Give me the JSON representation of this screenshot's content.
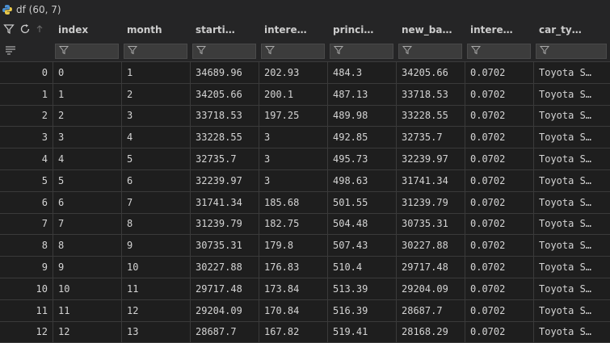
{
  "title": "df (60, 7)",
  "columns": [
    "index",
    "month",
    "starti…",
    "intere…",
    "princi…",
    "new_ba…",
    "intere…",
    "car_ty…"
  ],
  "rows": [
    [
      "0",
      "0",
      "1",
      "34689.96",
      "202.93",
      "484.3",
      "34205.66",
      "0.0702",
      "Toyota S…"
    ],
    [
      "1",
      "1",
      "2",
      "34205.66",
      "200.1",
      "487.13",
      "33718.53",
      "0.0702",
      "Toyota S…"
    ],
    [
      "2",
      "2",
      "3",
      "33718.53",
      "197.25",
      "489.98",
      "33228.55",
      "0.0702",
      "Toyota S…"
    ],
    [
      "3",
      "3",
      "4",
      "33228.55",
      "3",
      "492.85",
      "32735.7",
      "0.0702",
      "Toyota S…"
    ],
    [
      "4",
      "4",
      "5",
      "32735.7",
      "3",
      "495.73",
      "32239.97",
      "0.0702",
      "Toyota S…"
    ],
    [
      "5",
      "5",
      "6",
      "32239.97",
      "3",
      "498.63",
      "31741.34",
      "0.0702",
      "Toyota S…"
    ],
    [
      "6",
      "6",
      "7",
      "31741.34",
      "185.68",
      "501.55",
      "31239.79",
      "0.0702",
      "Toyota S…"
    ],
    [
      "7",
      "7",
      "8",
      "31239.79",
      "182.75",
      "504.48",
      "30735.31",
      "0.0702",
      "Toyota S…"
    ],
    [
      "8",
      "8",
      "9",
      "30735.31",
      "179.8",
      "507.43",
      "30227.88",
      "0.0702",
      "Toyota S…"
    ],
    [
      "9",
      "9",
      "10",
      "30227.88",
      "176.83",
      "510.4",
      "29717.48",
      "0.0702",
      "Toyota S…"
    ],
    [
      "10",
      "10",
      "11",
      "29717.48",
      "173.84",
      "513.39",
      "29204.09",
      "0.0702",
      "Toyota S…"
    ],
    [
      "11",
      "11",
      "12",
      "29204.09",
      "170.84",
      "516.39",
      "28687.7",
      "0.0702",
      "Toyota S…"
    ],
    [
      "12",
      "12",
      "13",
      "28687.7",
      "167.82",
      "519.41",
      "28168.29",
      "0.0702",
      "Toyota S…"
    ]
  ],
  "icons": {
    "title": "python-icon",
    "header": [
      "filter-icon",
      "refresh-icon",
      "sort-arrow-icon"
    ],
    "filter_row_left": "list-filter-icon",
    "column_filter": "filter-icon"
  },
  "colors": {
    "background": "#1e1e1e",
    "header": "#252526",
    "filter_box": "#3c3c3c",
    "text": "#d4d4d4"
  }
}
